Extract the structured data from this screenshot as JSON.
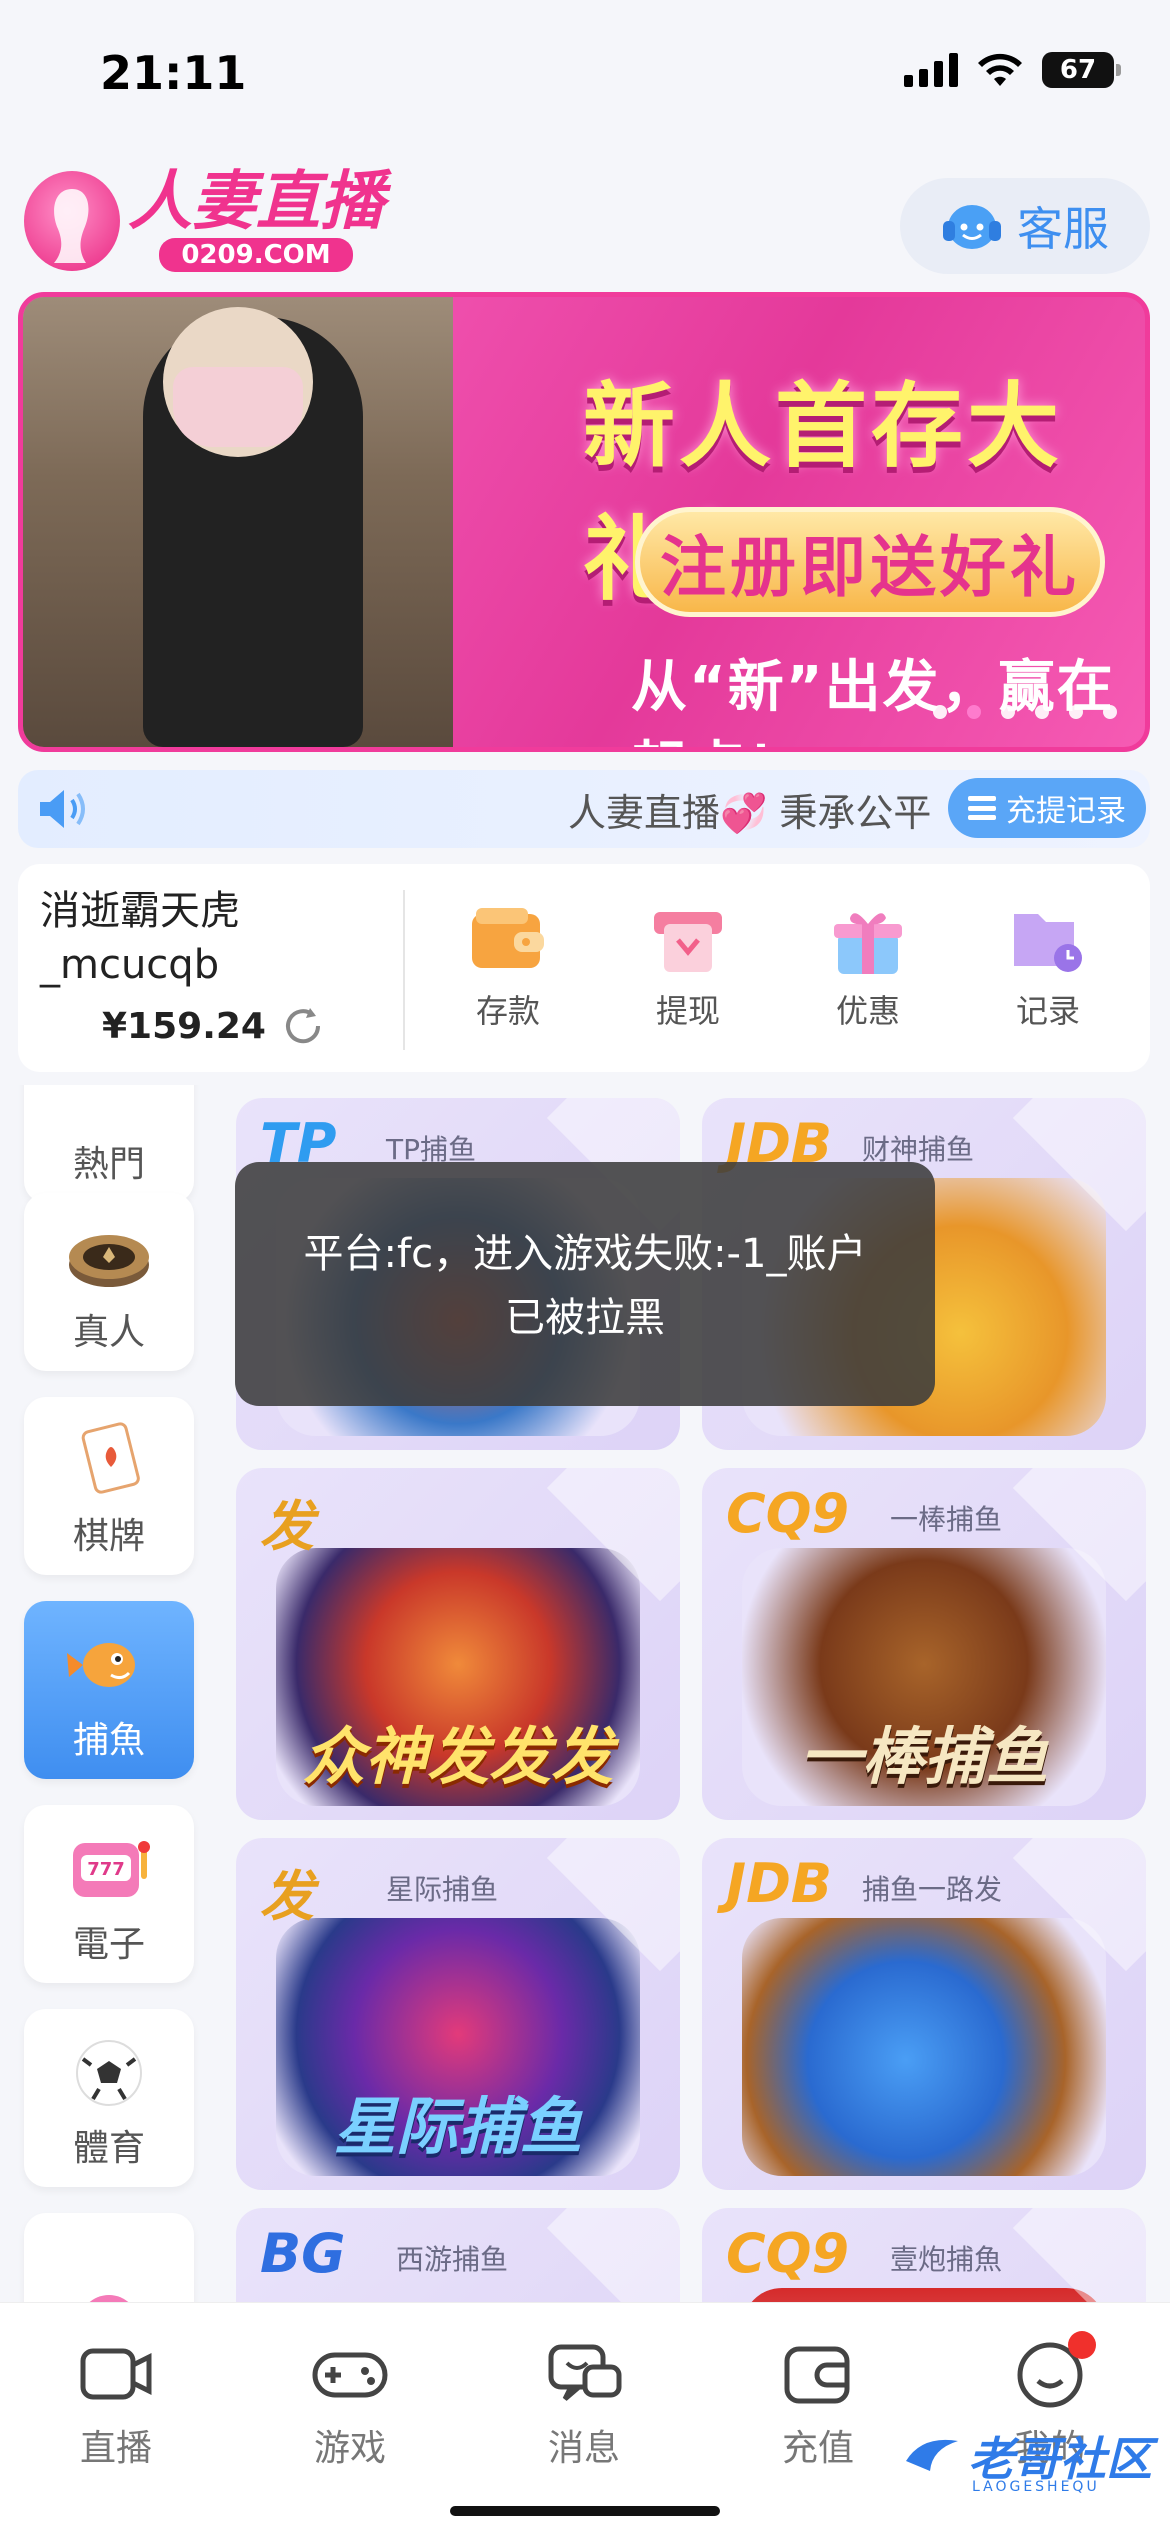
{
  "status_bar": {
    "time": "21:11",
    "battery": "67"
  },
  "header": {
    "logo_title": "人妻直播",
    "logo_sub": "0209.COM",
    "service_label": "客服"
  },
  "banner": {
    "title": "新人首存大礼包",
    "pill_text": "注册即送好礼",
    "slogan": "从“新”出发，赢在起点！",
    "dot_count": 6,
    "active_dot": 1
  },
  "marquee": {
    "text": "人妻直播💞 秉承公平",
    "record_button": "充提记录"
  },
  "account": {
    "username": "消逝霸天虎_mcucqb",
    "balance": "¥159.24",
    "actions": [
      {
        "label": "存款",
        "icon": "wallet-icon"
      },
      {
        "label": "提现",
        "icon": "withdraw-icon"
      },
      {
        "label": "优惠",
        "icon": "gift-icon"
      },
      {
        "label": "记录",
        "icon": "record-folder-icon"
      }
    ]
  },
  "categories": [
    {
      "label": "熱門",
      "icon": "hot-icon",
      "active": false
    },
    {
      "label": "真人",
      "icon": "casino-chip-icon",
      "active": false
    },
    {
      "label": "棋牌",
      "icon": "playing-card-icon",
      "active": false
    },
    {
      "label": "捕魚",
      "icon": "fish-icon",
      "active": true
    },
    {
      "label": "電子",
      "icon": "slot-machine-icon",
      "active": false
    },
    {
      "label": "體育",
      "icon": "soccer-ball-icon",
      "active": false
    },
    {
      "label": "",
      "icon": "lottery-ball-icon",
      "active": false
    }
  ],
  "games": [
    {
      "brand": "TP",
      "name": "TP捕鱼",
      "title": "",
      "brand_color": "#2f9cf0"
    },
    {
      "brand": "JDB",
      "name": "财神捕鱼",
      "title": "",
      "brand_color": "#f5a623"
    },
    {
      "brand": "发",
      "name": "",
      "title": "众神发发发",
      "brand_color": "#e8a020"
    },
    {
      "brand": "CQ9",
      "name": "一棒捕鱼",
      "title": "一棒捕鱼",
      "brand_color": "#f5a623"
    },
    {
      "brand": "发",
      "name": "星际捕鱼",
      "title": "星际捕鱼",
      "brand_color": "#e8a020"
    },
    {
      "brand": "JDB",
      "name": "捕鱼一路发",
      "title": "",
      "brand_color": "#f5a623"
    },
    {
      "brand": "BG",
      "name": "西游捕鱼",
      "title": "",
      "brand_color": "#2f6ee0"
    },
    {
      "brand": "CQ9",
      "name": "壹炮捕魚",
      "title": "",
      "brand_color": "#f5a623"
    }
  ],
  "toast": {
    "message": "平台:fc，进入游戏失败:-1_账户已被拉黑"
  },
  "bottom_nav": [
    {
      "label": "直播",
      "icon": "camera-icon"
    },
    {
      "label": "游戏",
      "icon": "gamepad-icon"
    },
    {
      "label": "消息",
      "icon": "message-icon"
    },
    {
      "label": "充值",
      "icon": "wallet-icon"
    },
    {
      "label": "我的",
      "icon": "profile-icon",
      "badge": true
    }
  ],
  "watermark": {
    "text": "老哥社区",
    "sub": "LAOGESHEQU"
  },
  "colors": {
    "accent": "#3f8ef0",
    "brand_pink": "#f0338e"
  }
}
